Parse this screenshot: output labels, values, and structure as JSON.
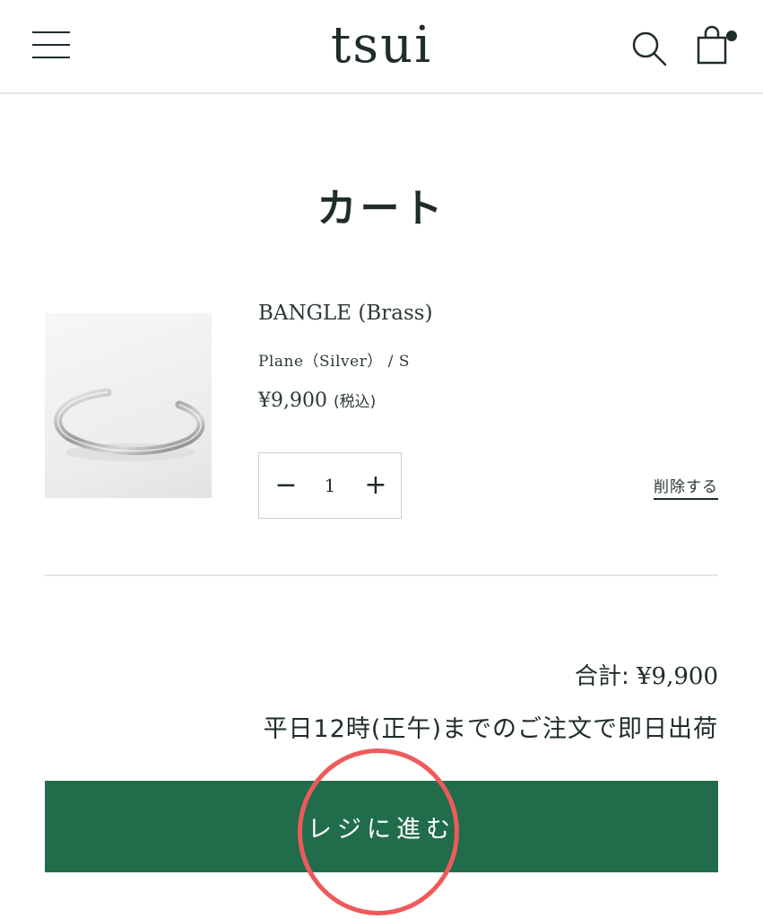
{
  "header": {
    "logo": "tsui"
  },
  "page": {
    "title": "カート"
  },
  "cart_item": {
    "name": "BANGLE (Brass)",
    "variant": "Plane（Silver） / S",
    "price": "¥9,900",
    "tax_label": "(税込)",
    "quantity": "1",
    "minus_label": "−",
    "plus_label": "+",
    "remove_label": "削除する"
  },
  "summary": {
    "total_label": "合計: ",
    "total_amount": "¥9,900",
    "shipping_note": "平日12時(正午)までのご注文で即日出荷",
    "checkout_label": "レジに進む"
  },
  "icons": {
    "menu": "menu-icon",
    "search": "search-icon",
    "cart": "cart-icon",
    "cart_badge": "cart-badge-dot"
  },
  "colors": {
    "accent_green": "#216d4b",
    "text_dark": "#1f2d28",
    "highlight_red": "#ee5a5a"
  }
}
